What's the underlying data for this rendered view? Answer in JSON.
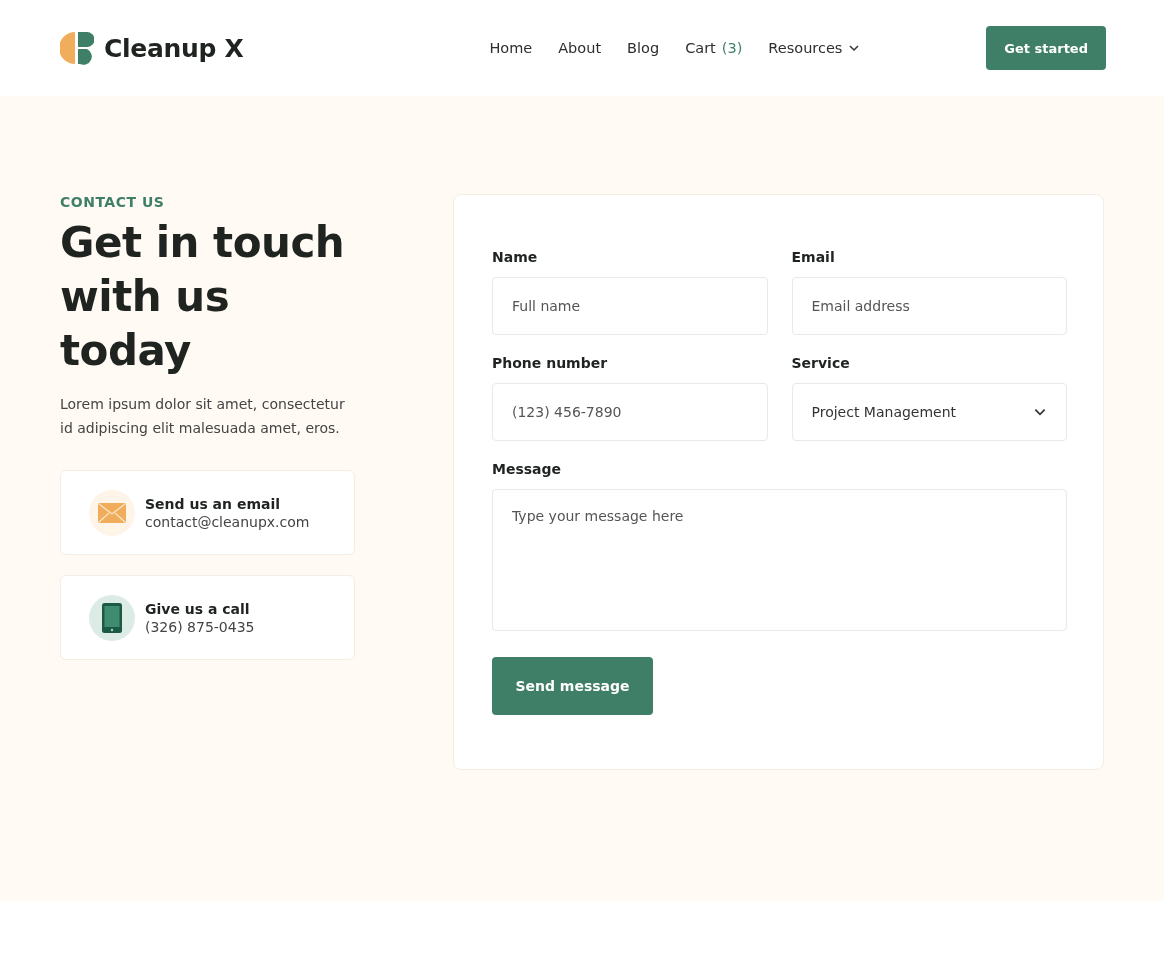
{
  "header": {
    "logo": "Cleanup X",
    "nav": [
      {
        "label": "Home",
        "kind": "link"
      },
      {
        "label": "About",
        "kind": "link"
      },
      {
        "label": "Blog",
        "kind": "link"
      },
      {
        "label": "Cart",
        "kind": "cart",
        "count": "(3)"
      },
      {
        "label": "Resources",
        "kind": "dropdown"
      }
    ],
    "cta": "Get started"
  },
  "contact": {
    "eyebrow": "CONTACT US",
    "title": "Get in touch with us today",
    "text": "Lorem ipsum dolor sit amet, consectetur id adipiscing elit malesuada amet, eros.",
    "cards": [
      {
        "kind": "email",
        "title": "Send us an email",
        "detail": "contact@cleanupx.com"
      },
      {
        "kind": "phone",
        "title": "Give us a call",
        "detail": "(326) 875-0435"
      }
    ]
  },
  "form": {
    "fields": [
      {
        "kind": "text",
        "label": "Name",
        "placeholder": "Full name"
      },
      {
        "kind": "text",
        "label": "Email",
        "placeholder": "Email address"
      },
      {
        "kind": "text",
        "label": "Phone number",
        "placeholder": "(123) 456-7890"
      },
      {
        "kind": "select",
        "label": "Service",
        "value": "Project Management"
      },
      {
        "kind": "textarea",
        "label": "Message",
        "placeholder": "Type your message here"
      }
    ],
    "submit": "Send message"
  }
}
